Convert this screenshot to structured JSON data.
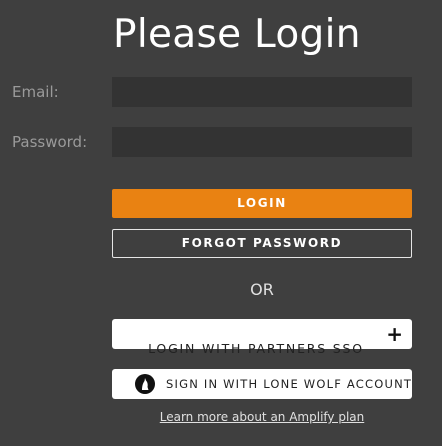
{
  "header": {
    "title": "Please Login"
  },
  "form": {
    "email_label": "Email:",
    "email_value": "",
    "password_label": "Password:",
    "password_value": ""
  },
  "buttons": {
    "login": "LOGIN",
    "forgot": "FORGOT PASSWORD",
    "sso": "LOGIN WITH PARTNERS SSO",
    "sso_expand": "+",
    "lonewolf": "SIGN IN WITH LONE WOLF ACCOUNT"
  },
  "separator": {
    "or": "OR"
  },
  "footer": {
    "learn_more": "Learn more about an Amplify plan"
  },
  "icons": {
    "sso_expand": "plus-icon",
    "lonewolf": "wolf-logo-icon"
  },
  "colors": {
    "background": "#3f3f3f",
    "input_bg": "#333333",
    "accent": "#e98212",
    "text": "#ffffff",
    "label": "#9a9a9a"
  }
}
